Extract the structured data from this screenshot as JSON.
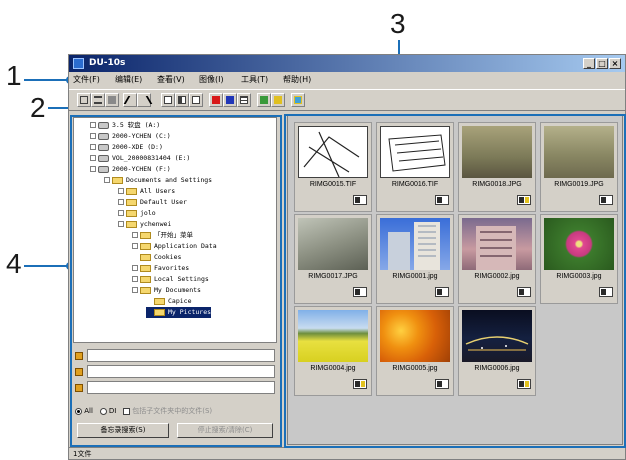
{
  "callouts": [
    "1",
    "2",
    "3",
    "4"
  ],
  "window": {
    "title": "DU-10s",
    "buttons": [
      "_",
      "□",
      "×"
    ]
  },
  "menu": [
    "文件(F)",
    "编辑(E)",
    "查看(V)",
    "图像(I)",
    "工具(T)",
    "帮助(H)"
  ],
  "toolbar_icons": [
    "thumbnail-view-icon",
    "list-view-icon",
    "detail-view-icon",
    "rotate-left-icon",
    "rotate-right-icon",
    "single-pane-icon",
    "dual-pane-icon",
    "grid-pane-icon",
    "red-color-icon",
    "blue-color-icon",
    "table-icon",
    "convert-icon",
    "edit-icon",
    "slideshow-icon"
  ],
  "tree": [
    "3.5 软盘 (A:)",
    "2000-YCHEN (C:)",
    "2000-XDE (D:)",
    "VOL_20000831404 (E:)",
    "2000-YCHEN (F:)",
    "Documents and Settings",
    "All Users",
    "Default User",
    "jolo",
    "ychenwei",
    "「开始」菜单",
    "Application Data",
    "Cookies",
    "Favorites",
    "Local Settings",
    "My Documents",
    "Capice",
    "My Pictures"
  ],
  "options": {
    "all_label": "All",
    "dir_label": "DI",
    "subfolder_label": "包括子文件夹中的文件(S)"
  },
  "buttons": {
    "search": "备忘录搜索(S)",
    "clear": "停止搜索/清除(C)"
  },
  "thumbnails": [
    {
      "name": "RIMG0015.TIF",
      "badge": "plain"
    },
    {
      "name": "RIMG0016.TIF",
      "badge": "plain"
    },
    {
      "name": "RIMG0018.JPG",
      "badge": "yellow"
    },
    {
      "name": "RIMG0019.JPG",
      "badge": "plain"
    },
    {
      "name": "RIMG0017.JPG",
      "badge": "plain"
    },
    {
      "name": "RIMG0001.jpg",
      "badge": "plain"
    },
    {
      "name": "RIMG0002.jpg",
      "badge": "plain"
    },
    {
      "name": "RIMG0003.jpg",
      "badge": "plain"
    },
    {
      "name": "RIMG0004.jpg",
      "badge": "yellow"
    },
    {
      "name": "RIMG0005.jpg",
      "badge": "plain"
    },
    {
      "name": "RIMG0006.jpg",
      "badge": "yellow"
    }
  ],
  "status": "1文件",
  "colors": {
    "accent": "#1b6fb8",
    "titlebar": "#0a246a",
    "chrome": "#d4d0c8"
  }
}
